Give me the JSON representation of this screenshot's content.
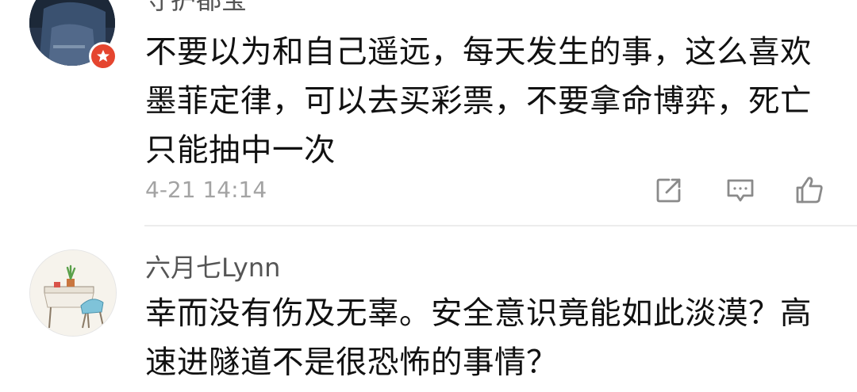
{
  "comments": [
    {
      "username": "守护都宝",
      "text": "不要以为和自己遥远，每天发生的事，这么喜欢墨菲定律，可以去买彩票，不要拿命博弈，死亡只能抽中一次",
      "time": "4-21 14:14",
      "actions": [
        "share-icon",
        "reply-icon",
        "like-icon"
      ],
      "avatar_badge_color": "#e5452f"
    },
    {
      "username": "六月七Lynn",
      "text": "幸而没有伤及无辜。安全意识竟能如此淡漠？高速进隧道不是很恐怖的事情？"
    }
  ],
  "colors": {
    "username": "#555555",
    "body_text": "#111111",
    "timestamp": "#a3a3a3",
    "icon": "#8a8a8a",
    "divider": "#ececec"
  }
}
